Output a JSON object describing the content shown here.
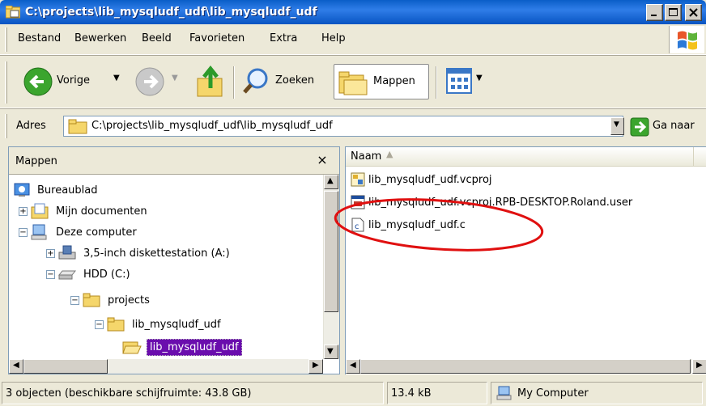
{
  "window": {
    "title": "C:\\projects\\lib_mysqludf_udf\\lib_mysqludf_udf",
    "icons": {
      "app": "folder-window-icon",
      "minimize": "minimize-icon",
      "maximize": "maximize-icon",
      "close": "close-icon"
    }
  },
  "menubar": {
    "items": [
      "Bestand",
      "Bewerken",
      "Beeld",
      "Favorieten",
      "Extra",
      "Help"
    ],
    "logo_icon": "windows-flag-icon"
  },
  "toolbar": {
    "back_label": "Vorige",
    "search_label": "Zoeken",
    "folders_label": "Mappen",
    "icons": [
      "back-arrow-icon",
      "forward-arrow-icon",
      "up-folder-icon",
      "search-magnifier-icon",
      "folders-icon",
      "views-icon"
    ]
  },
  "addressbar": {
    "label": "Adres",
    "value": "C:\\projects\\lib_mysqludf_udf\\lib_mysqludf_udf",
    "go_label": "Ga naar"
  },
  "folder_pane": {
    "title": "Mappen",
    "close_glyph": "×",
    "tree": [
      {
        "label": "Bureaublad",
        "icon": "desktop-icon"
      },
      {
        "label": "Mijn documenten",
        "icon": "documents-folder-icon",
        "expander": "+"
      },
      {
        "label": "Deze computer",
        "icon": "computer-icon",
        "expander": "−"
      },
      {
        "label": "3,5-inch diskettestation (A:)",
        "icon": "floppy-drive-icon",
        "expander": "+"
      },
      {
        "label": "HDD (C:)",
        "icon": "hard-drive-icon",
        "expander": "−"
      },
      {
        "label": "projects",
        "icon": "folder-icon",
        "expander": "−"
      },
      {
        "label": "lib_mysqludf_udf",
        "icon": "folder-icon",
        "expander": "−"
      },
      {
        "label": "lib_mysqludf_udf",
        "icon": "folder-open-icon",
        "selected": true
      }
    ]
  },
  "file_pane": {
    "column_header": "Naam",
    "files": [
      {
        "name": "lib_mysqludf_udf.vcproj",
        "icon": "vcproj-file-icon"
      },
      {
        "name": "lib_mysqludf_udf.vcproj.RPB-DESKTOP.Roland.user",
        "icon": "user-file-icon"
      },
      {
        "name": "lib_mysqludf_udf.c",
        "icon": "c-source-file-icon"
      }
    ],
    "annotation_color": "#E01010"
  },
  "statusbar": {
    "objects": "3 objecten (beschikbare schijfruimte: 43.8 GB)",
    "size": "13.4 kB",
    "location": "My Computer"
  },
  "colors": {
    "titlebar": "#0A5EC8",
    "selection": "#6A0DAD",
    "chrome": "#ECE9D8"
  }
}
